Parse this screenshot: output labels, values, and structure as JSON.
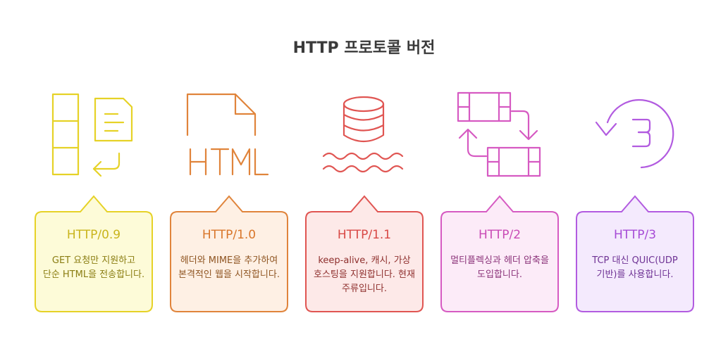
{
  "title": "HTTP 프로토콜 버전",
  "versions": [
    {
      "name": "HTTP/0.9",
      "desc": "GET 요청만 지원하고 단순 HTML을 전송합니다.",
      "icon": "document-list-icon",
      "color": "#e6d227",
      "fill": "#fdfbd8"
    },
    {
      "name": "HTTP/1.0",
      "desc": "헤더와 MIME을 추가하여 본격적인 웹을 시작합니다.",
      "icon": "html-file-icon",
      "color": "#e0843b",
      "fill": "#fef0e4"
    },
    {
      "name": "HTTP/1.1",
      "desc": "keep-alive, 캐시, 가상 호스팅을 지원합니다. 현재 주류입니다.",
      "icon": "database-icon",
      "color": "#e05552",
      "fill": "#fde9e8"
    },
    {
      "name": "HTTP/2",
      "desc": "멀티플렉싱과 헤더 압축을 도입합니다.",
      "icon": "multiplex-icon",
      "color": "#d65ac2",
      "fill": "#fcebf8"
    },
    {
      "name": "HTTP/3",
      "desc": "TCP 대신 QUIC(UDP 기반)를 사용합니다.",
      "icon": "rotate-three-icon",
      "color": "#b25be0",
      "fill": "#f4eafd"
    }
  ]
}
